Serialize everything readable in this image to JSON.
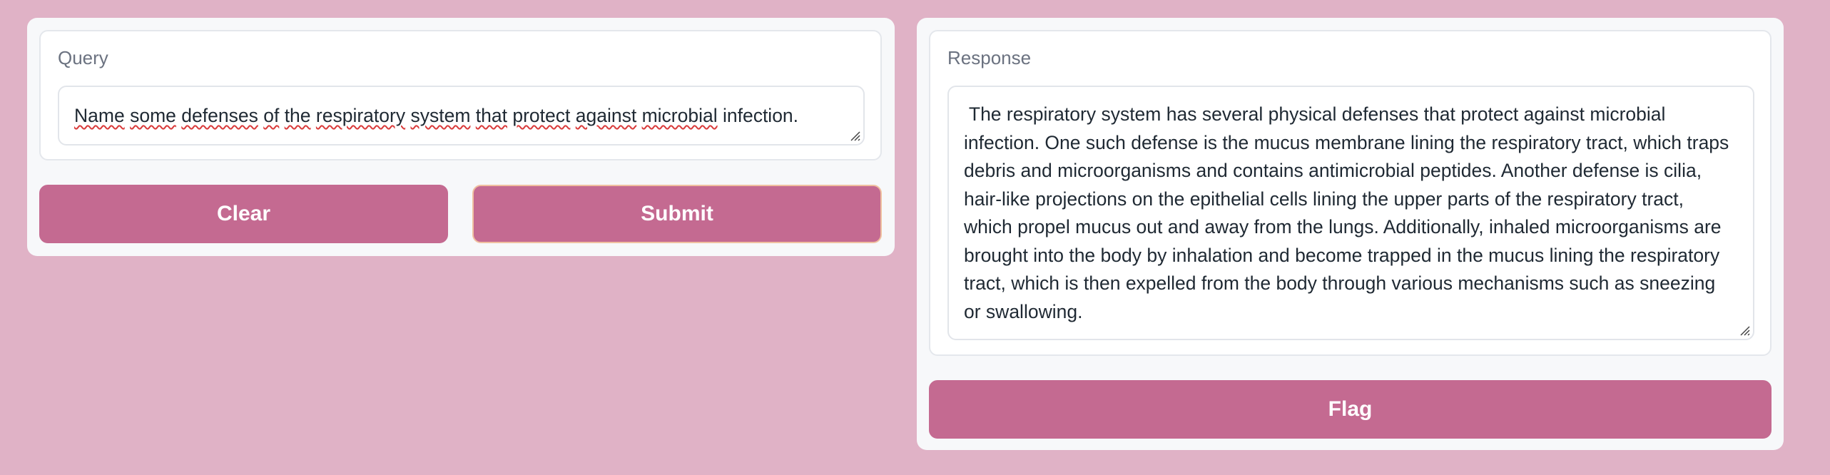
{
  "query": {
    "label": "Query",
    "misspelled_words": [
      "Name",
      "some",
      "defenses",
      "of",
      "the",
      "respiratory",
      "system",
      "that",
      "protect",
      "against",
      "microbial"
    ],
    "trailing_text": " infection."
  },
  "buttons": {
    "clear_label": "Clear",
    "submit_label": "Submit",
    "flag_label": "Flag"
  },
  "response": {
    "label": "Response",
    "lines": [
      " The respiratory system has several physical defenses that protect against microbial",
      "infection. One such defense is the mucus membrane lining the respiratory tract, which traps",
      "debris and microorganisms and contains antimicrobial peptides. Another defense is cilia,",
      "hair-like projections on the epithelial cells lining the upper parts of the respiratory tract,",
      "which propel mucus out and away from the lungs. Additionally, inhaled microorganisms are",
      "brought into the body by inhalation and become trapped in the mucus lining the respiratory",
      "tract, which is then expelled from the body through various mechanisms such as sneezing",
      "or swallowing."
    ]
  },
  "colors": {
    "background": "#e0b2c6",
    "button": "#c46a91",
    "panel": "#f7f8fa",
    "spellcheck": "#d93a3a"
  },
  "icons": {
    "resize": "resize-handle-icon"
  }
}
